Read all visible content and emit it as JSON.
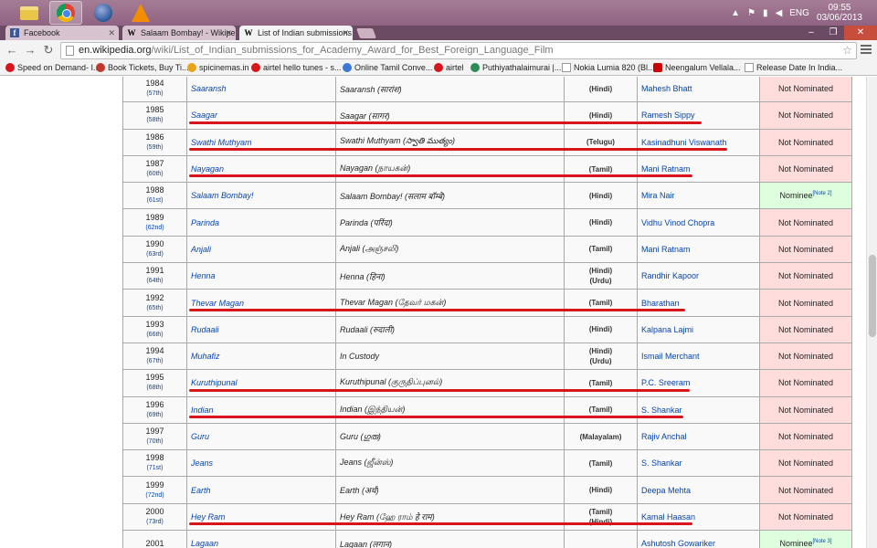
{
  "taskbar": {
    "icons": [
      "folder-icon",
      "chrome-icon",
      "globe-icon",
      "vlc-icon"
    ],
    "language": "ENG",
    "time": "09:55",
    "date": "03/06/2013"
  },
  "tabs": [
    {
      "label": "Facebook",
      "favicon": "f"
    },
    {
      "label": "Salaam Bombay! - Wikipe",
      "favicon": "W"
    },
    {
      "label": "List of Indian submissions",
      "favicon": "W"
    }
  ],
  "omnibox": {
    "host": "en.wikipedia.org",
    "path": "/wiki/List_of_Indian_submissions_for_Academy_Award_for_Best_Foreign_Language_Film"
  },
  "bookmarks": [
    {
      "label": "Speed on Demand- I...",
      "color": "#d8141c"
    },
    {
      "label": "Book Tickets, Buy Ti...",
      "color": "#c0392b"
    },
    {
      "label": "spicinemas.in",
      "color": "#e8a317"
    },
    {
      "label": "airtel hello tunes - s...",
      "color": "#d8141c"
    },
    {
      "label": "Online Tamil Conve...",
      "color": "#3c78d8"
    },
    {
      "label": "airtel",
      "color": "#d8141c"
    },
    {
      "label": "Puthiyathalaimurai |...",
      "color": "#2e8b57"
    },
    {
      "label": "Nokia Lumia 820 (Bl...",
      "color": "#ffffff"
    },
    {
      "label": "Neengalum Vellala...",
      "color": "#cc0000"
    },
    {
      "label": "Release Date In India...",
      "color": "#ffffff"
    }
  ],
  "table": {
    "rows": [
      {
        "year": "1984",
        "edition": "(57th)",
        "title": "Saaransh",
        "original": "Saaransh (सारांश)",
        "languages": [
          "(Hindi)"
        ],
        "director": "Mahesh Bhatt",
        "result": "Not Nominated",
        "note": "",
        "status": "nn",
        "underlined": false
      },
      {
        "year": "1985",
        "edition": "(58th)",
        "title": "Saagar",
        "original": "Saagar (सागर)",
        "languages": [
          "(Hindi)"
        ],
        "director": "Ramesh Sippy",
        "result": "Not Nominated",
        "note": "",
        "status": "nn",
        "underlined": true
      },
      {
        "year": "1986",
        "edition": "(59th)",
        "title": "Swathi Muthyam",
        "original": "Swathi Muthyam (స్వాతి ముత్యం)",
        "languages": [
          "(Telugu)"
        ],
        "director": "Kasinadhuni Viswanath",
        "result": "Not Nominated",
        "note": "",
        "status": "nn",
        "underlined": true
      },
      {
        "year": "1987",
        "edition": "(60th)",
        "title": "Nayagan",
        "original": "Nayagan (நாயகன்)",
        "languages": [
          "(Tamil)"
        ],
        "director": "Mani Ratnam",
        "result": "Not Nominated",
        "note": "",
        "status": "nn",
        "underlined": true
      },
      {
        "year": "1988",
        "edition": "(61st)",
        "title": "Salaam Bombay!",
        "original": "Salaam Bombay! (सलाम बॉम्बे)",
        "languages": [
          "(Hindi)"
        ],
        "director": "Mira Nair",
        "result": "Nominee",
        "note": "[Note 2]",
        "status": "nom",
        "underlined": false
      },
      {
        "year": "1989",
        "edition": "(62nd)",
        "title": "Parinda",
        "original": "Parinda (परिंदा)",
        "languages": [
          "(Hindi)"
        ],
        "director": "Vidhu Vinod Chopra",
        "result": "Not Nominated",
        "note": "",
        "status": "nn",
        "underlined": false
      },
      {
        "year": "1990",
        "edition": "(63rd)",
        "title": "Anjali",
        "original": "Anjali (அஞ்சலி)",
        "languages": [
          "(Tamil)"
        ],
        "director": "Mani Ratnam",
        "result": "Not Nominated",
        "note": "",
        "status": "nn",
        "underlined": false
      },
      {
        "year": "1991",
        "edition": "(64th)",
        "title": "Henna",
        "original": "Henna (हिना)",
        "languages": [
          "(Hindi)",
          "(Urdu)"
        ],
        "director": "Randhir Kapoor",
        "result": "Not Nominated",
        "note": "",
        "status": "nn",
        "underlined": false
      },
      {
        "year": "1992",
        "edition": "(65th)",
        "title": "Thevar Magan",
        "original": "Thevar Magan (தேவர் மகன்)",
        "languages": [
          "(Tamil)"
        ],
        "director": "Bharathan",
        "result": "Not Nominated",
        "note": "",
        "status": "nn",
        "underlined": true
      },
      {
        "year": "1993",
        "edition": "(66th)",
        "title": "Rudaali",
        "original": "Rudaali (रुदाली)",
        "languages": [
          "(Hindi)"
        ],
        "director": "Kalpana Lajmi",
        "result": "Not Nominated",
        "note": "",
        "status": "nn",
        "underlined": false
      },
      {
        "year": "1994",
        "edition": "(67th)",
        "title": "Muhafiz",
        "original": "In Custody",
        "languages": [
          "(Hindi)",
          "(Urdu)"
        ],
        "director": "Ismail Merchant",
        "result": "Not Nominated",
        "note": "",
        "status": "nn",
        "underlined": false
      },
      {
        "year": "1995",
        "edition": "(68th)",
        "title": "Kuruthipunal",
        "original": "Kuruthipunal (குருதிப்புனல்)",
        "languages": [
          "(Tamil)"
        ],
        "director": "P.C. Sreeram",
        "result": "Not Nominated",
        "note": "",
        "status": "nn",
        "underlined": true
      },
      {
        "year": "1996",
        "edition": "(69th)",
        "title": "Indian",
        "original": "Indian (இந்தியன்)",
        "languages": [
          "(Tamil)"
        ],
        "director": "S. Shankar",
        "result": "Not Nominated",
        "note": "",
        "status": "nn",
        "underlined": true
      },
      {
        "year": "1997",
        "edition": "(70th)",
        "title": "Guru",
        "original": "Guru (ഗുരു)",
        "languages": [
          "(Malayalam)"
        ],
        "director": "Rajiv Anchal",
        "result": "Not Nominated",
        "note": "",
        "status": "nn",
        "underlined": false
      },
      {
        "year": "1998",
        "edition": "(71st)",
        "title": "Jeans",
        "original": "Jeans (ஜீன்ஸ்)",
        "languages": [
          "(Tamil)"
        ],
        "director": "S. Shankar",
        "result": "Not Nominated",
        "note": "",
        "status": "nn",
        "underlined": false
      },
      {
        "year": "1999",
        "edition": "(72nd)",
        "title": "Earth",
        "original": "Earth (अर्थ)",
        "languages": [
          "(Hindi)"
        ],
        "director": "Deepa Mehta",
        "result": "Not Nominated",
        "note": "",
        "status": "nn",
        "underlined": false
      },
      {
        "year": "2000",
        "edition": "(73rd)",
        "title": "Hey Ram",
        "original": "Hey Ram (ஹே ராம் हे राम)",
        "languages": [
          "(Tamil)",
          "(Hindi)"
        ],
        "director": "Kamal Haasan",
        "result": "Not Nominated",
        "note": "",
        "status": "nn",
        "underlined": true
      },
      {
        "year": "2001",
        "edition": "",
        "title": "Lagaan",
        "original": "Lagaan (लगान)",
        "languages": [
          ""
        ],
        "director": "Ashutosh Gowariker",
        "result": "Nominee",
        "note": "[Note 3]",
        "status": "nom",
        "underlined": false
      }
    ]
  },
  "colors": {
    "link": "#0645ad",
    "not_nominated_bg": "#ffdddd",
    "nominee_bg": "#ddffdd",
    "annotation_red": "#d8141c",
    "taskbar": "#9a6e8a"
  }
}
